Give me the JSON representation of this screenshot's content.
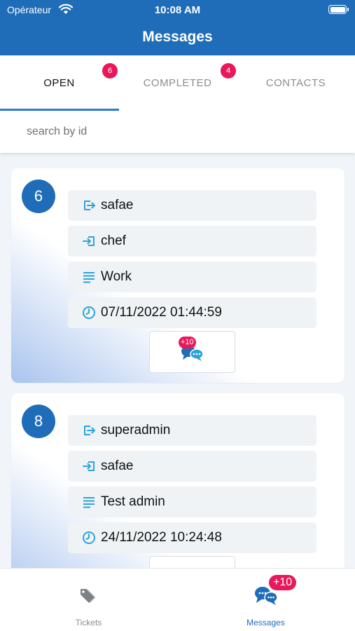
{
  "status_bar": {
    "carrier": "Opérateur",
    "time": "10:08 AM"
  },
  "header": {
    "title": "Messages"
  },
  "tabs": [
    {
      "label": "OPEN",
      "badge": "6",
      "active": true
    },
    {
      "label": "COMPLETED",
      "badge": "4",
      "active": false
    },
    {
      "label": "CONTACTS",
      "active": false
    }
  ],
  "search": {
    "placeholder": "search by id",
    "value": ""
  },
  "tickets": [
    {
      "id": "6",
      "from": "safae",
      "to": "chef",
      "subject": "Work",
      "date": "07/11/2022 01:44:59",
      "chat_badge": "+10"
    },
    {
      "id": "8",
      "from": "superadmin",
      "to": "safae",
      "subject": "Test admin",
      "date": "24/11/2022 10:24:48"
    }
  ],
  "bottom_nav": {
    "tickets": {
      "label": "Tickets",
      "icon": "tag-icon"
    },
    "messages": {
      "label": "Messages",
      "icon": "chat-bubbles-icon",
      "badge": "+10"
    }
  },
  "colors": {
    "primary": "#1f6db8",
    "badge": "#e8185b",
    "icon_accent": "#2ba3dd",
    "tab_indicator": "#2c7bd0"
  }
}
